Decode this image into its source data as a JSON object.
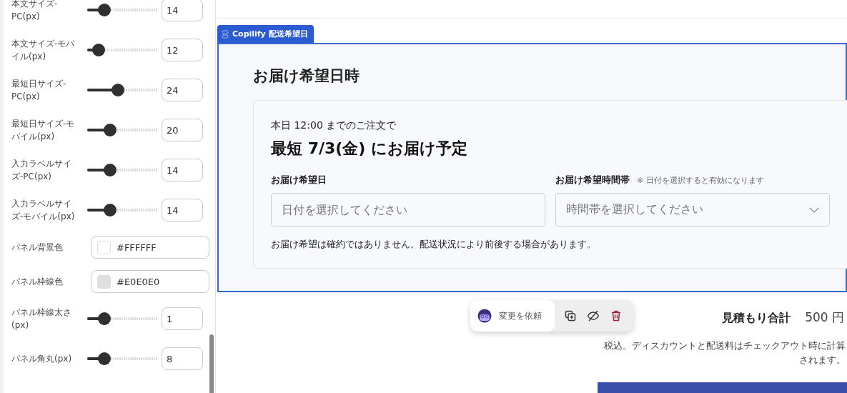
{
  "settings": [
    {
      "kind": "slider",
      "label": "本文サイズ-PC(px)",
      "level": 0.24,
      "value": "14"
    },
    {
      "kind": "slider",
      "label": "本文サイズ-モバイル(px)",
      "level": 0.16,
      "value": "12"
    },
    {
      "kind": "slider",
      "label": "最短日サイズ-PC(px)",
      "level": 0.44,
      "value": "24"
    },
    {
      "kind": "slider",
      "label": "最短日サイズ-モバイル(px)",
      "level": 0.33,
      "value": "20"
    },
    {
      "kind": "slider",
      "label": "入力ラベルサイズ-PC(px)",
      "level": 0.33,
      "value": "14"
    },
    {
      "kind": "slider",
      "label": "入力ラベルサイズ-モバイル(px)",
      "level": 0.33,
      "value": "14"
    },
    {
      "kind": "color",
      "label": "パネル背景色",
      "color": "#ffffff",
      "value": "#FFFFFF"
    },
    {
      "kind": "color",
      "label": "パネル枠線色",
      "color": "#e0e0e0",
      "value": "#E0E0E0"
    },
    {
      "kind": "slider",
      "label": "パネル枠線太さ(px)",
      "level": 0.24,
      "value": "1"
    },
    {
      "kind": "slider",
      "label": "パネル角丸(px)",
      "level": 0.24,
      "value": "8"
    }
  ],
  "block_tag": {
    "label": "Copilify 配送希望日"
  },
  "section": {
    "heading": "お届け希望日時",
    "cutoff_text": "本日 12:00 までのご注文で",
    "earliest_text": "最短 7/3(金) にお届け予定",
    "date_field": {
      "label": "お届け希望日",
      "placeholder": "日付を選択してください"
    },
    "time_field": {
      "label": "お届け希望時間帯",
      "note": "※ 日付を選択すると有効になります",
      "placeholder": "時間帯を選択してください"
    },
    "disclaimer": "お届け希望は確約ではありません。配送状況により前後する場合があります。"
  },
  "toolbar": {
    "request_label": "変更を依頼"
  },
  "totals": {
    "label": "見積もり合計",
    "amount": "500 円",
    "note": "税込。ディスカウントと配送料はチェックアウト時に計算されます。"
  }
}
